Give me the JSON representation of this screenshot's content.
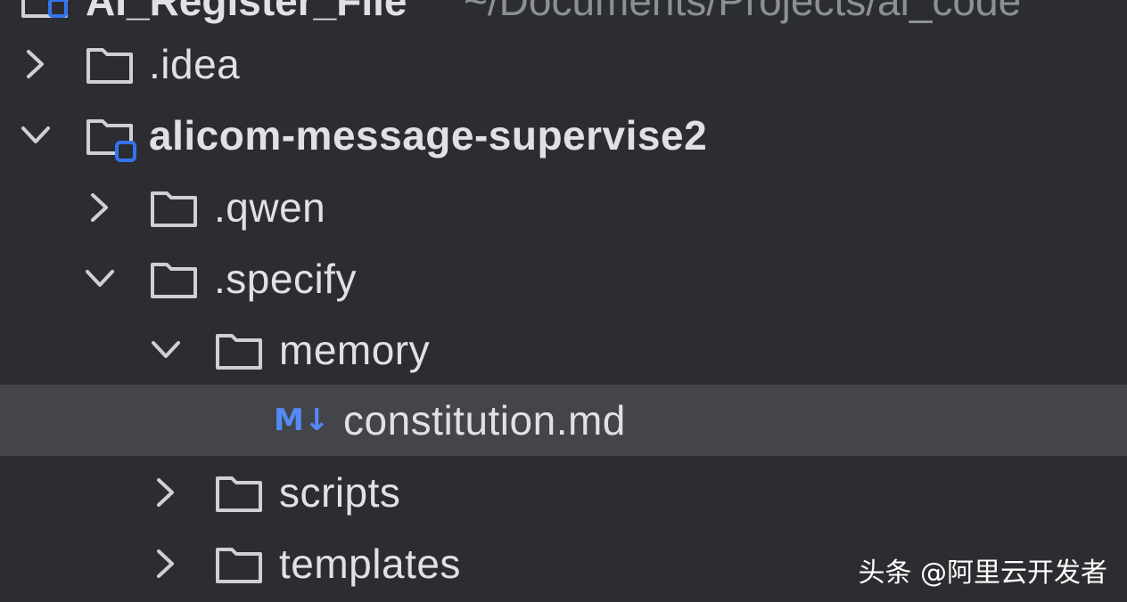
{
  "header": {
    "project_name": "AI_Register_File",
    "project_path": "~/Documents/Projects/ai_code"
  },
  "tree": {
    "items": [
      {
        "label": ".idea",
        "expanded": false,
        "type": "folder",
        "depth": 1
      },
      {
        "label": "alicom-message-supervise2",
        "expanded": true,
        "type": "module-folder",
        "depth": 1
      },
      {
        "label": ".qwen",
        "expanded": false,
        "type": "folder",
        "depth": 2
      },
      {
        "label": ".specify",
        "expanded": true,
        "type": "folder",
        "depth": 2
      },
      {
        "label": "memory",
        "expanded": true,
        "type": "folder",
        "depth": 3
      },
      {
        "label": "constitution.md",
        "type": "markdown-file",
        "icon_text": "M↓",
        "selected": true,
        "depth": 4
      },
      {
        "label": "scripts",
        "expanded": false,
        "type": "folder",
        "depth": 3
      },
      {
        "label": "templates",
        "expanded": false,
        "type": "folder",
        "depth": 3
      }
    ]
  },
  "watermark": {
    "text": "头条 @阿里云开发者"
  },
  "colors": {
    "background": "#2b2d30",
    "selected_row": "#43454a",
    "text": "#dfe1e5",
    "module_badge": "#3574f0",
    "markdown_icon": "#548af7"
  }
}
